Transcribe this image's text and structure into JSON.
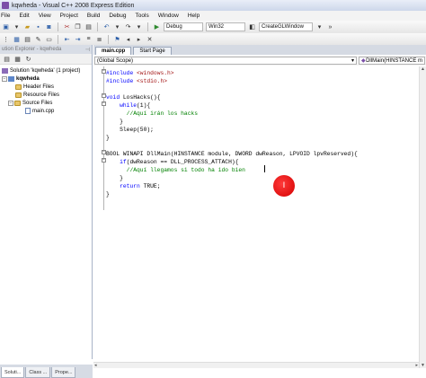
{
  "window": {
    "title": "kqwheda - Visual C++ 2008 Express Edition"
  },
  "menu": [
    "File",
    "Edit",
    "View",
    "Project",
    "Build",
    "Debug",
    "Tools",
    "Window",
    "Help"
  ],
  "toolbar": {
    "config": "Debug",
    "platform": "Win32",
    "find_combo": "CreateGLWindow"
  },
  "solution_explorer": {
    "header": "ution Explorer - kqwheda",
    "nodes": [
      {
        "label": "Solution 'kqwheda' (1 project)",
        "level": 0,
        "icon": "solution-icon"
      },
      {
        "label": "kqwheda",
        "level": 1,
        "icon": "project-icon",
        "bold": true
      },
      {
        "label": "Header Files",
        "level": 2,
        "icon": "folder-icon"
      },
      {
        "label": "Resource Files",
        "level": 2,
        "icon": "folder-icon"
      },
      {
        "label": "Source Files",
        "level": 2,
        "icon": "folder-icon"
      },
      {
        "label": "main.cpp",
        "level": 3,
        "icon": "cpp-file-icon"
      }
    ],
    "tabs": [
      "Soluti...",
      "Class ...",
      "Prope..."
    ]
  },
  "editor": {
    "tabs": [
      "main.cpp",
      "Start Page"
    ],
    "scope": "(Global Scope)",
    "member": "DllMain(HINSTANCE m",
    "lines": [
      "#include <windows.h>",
      "#include <stdio.h>",
      "",
      "void LosHacks(){",
      "    while(1){",
      "      //Aquí irán los hacks",
      "    }",
      "    Sleep(50);",
      "}",
      "",
      "BOOL WINAPI DllMain(HINSTANCE module, DWORD dwReason, LPVOID lpvReserved){",
      "    if(dwReason == DLL_PROCESS_ATTACH){",
      "      //Aquí llegamos si todo ha ido bien",
      "    }",
      "    return TRUE;",
      "}"
    ]
  },
  "colors": {
    "keyword": "#0000ff",
    "string": "#a31515",
    "comment": "#008000",
    "cursor_marker": "#e00000"
  }
}
